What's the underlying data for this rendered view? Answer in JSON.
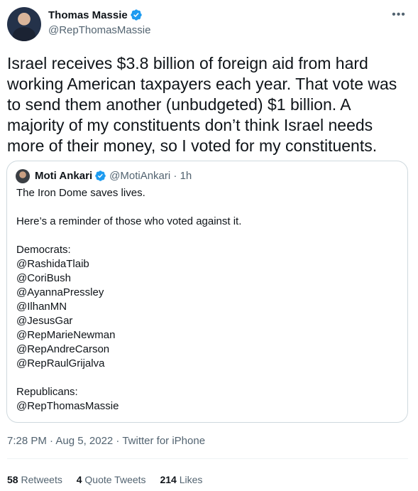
{
  "tweet": {
    "author": {
      "name": "Thomas Massie",
      "handle": "@RepThomasMassie",
      "verified": true
    },
    "text": "Israel receives $3.8 billion of foreign aid from hard working American taxpayers each year. That vote was to send them another (unbudgeted) $1 billion. A majority of my constituents don’t think Israel needs more of their money, so I voted for my constituents.",
    "more_icon": "more-horizontal-icon"
  },
  "quote": {
    "author": {
      "name": "Moti Ankari",
      "handle": "@MotiAnkari",
      "time": "1h",
      "verified": true
    },
    "lines": [
      "The Iron Dome saves lives.",
      "",
      "Here’s a reminder of those who voted against it.",
      "",
      "Democrats:",
      "@RashidaTlaib",
      "@CoriBush",
      "@AyannaPressley",
      "@IlhanMN",
      "@JesusGar",
      "@RepMarieNewman",
      "@RepAndreCarson",
      "@RepRaulGrijalva",
      "",
      "Republicans:",
      "@RepThomasMassie"
    ]
  },
  "meta": {
    "timestamp": "7:28 PM · Aug 5, 2022 · Twitter for iPhone"
  },
  "stats": {
    "retweets_count": "58",
    "retweets_label": "Retweets",
    "quotes_count": "4",
    "quotes_label": "Quote Tweets",
    "likes_count": "214",
    "likes_label": "Likes"
  },
  "colors": {
    "verified": "#1d9bf0",
    "secondary_text": "#536471",
    "border": "#cfd9de"
  }
}
